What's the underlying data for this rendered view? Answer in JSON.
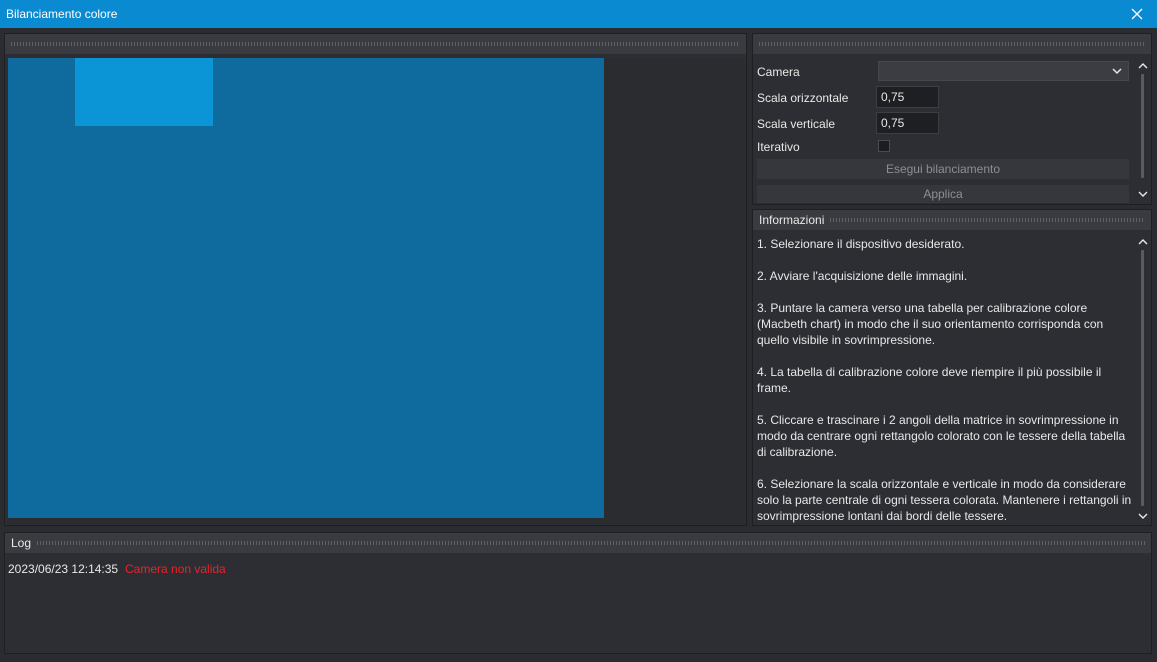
{
  "window": {
    "title": "Bilanciamento colore"
  },
  "settings": {
    "camera_label": "Camera",
    "camera_value": "",
    "scala_orizzontale_label": "Scala orizzontale",
    "scala_orizzontale_value": "0,75",
    "scala_verticale_label": "Scala verticale",
    "scala_verticale_value": "0,75",
    "iterativo_label": "Iterativo",
    "iterativo_checked": false,
    "esegui_button": "Esegui bilanciamento",
    "applica_button": "Applica"
  },
  "info": {
    "header": "Informazioni",
    "steps": [
      "1. Selezionare il dispositivo desiderato.",
      "2. Avviare l'acquisizione delle immagini.",
      "3. Puntare la camera verso una tabella per calibrazione colore (Macbeth chart) in modo che il suo orientamento corrisponda con quello visibile in sovrimpressione.",
      "4. La tabella di calibrazione colore deve riempire il più possibile il frame.",
      "5. Cliccare e trascinare i 2 angoli della matrice in sovrimpressione in modo da centrare ogni rettangolo colorato con le tessere della tabella di calibrazione.",
      "6. Selezionare la scala orizzontale e verticale in modo da considerare solo la parte centrale di ogni tessera colorata. Mantenere i rettangoli in sovrimpressione lontani dai bordi delle tessere."
    ]
  },
  "log": {
    "header": "Log",
    "entries": [
      {
        "time": "2023/06/23 12:14:35",
        "message": "Camera non valida"
      }
    ]
  },
  "colors": {
    "titlebar": "#0a8ad0",
    "preview": "#0f6a9e",
    "overlay": "#0b94d6",
    "error": "#e8232a"
  }
}
